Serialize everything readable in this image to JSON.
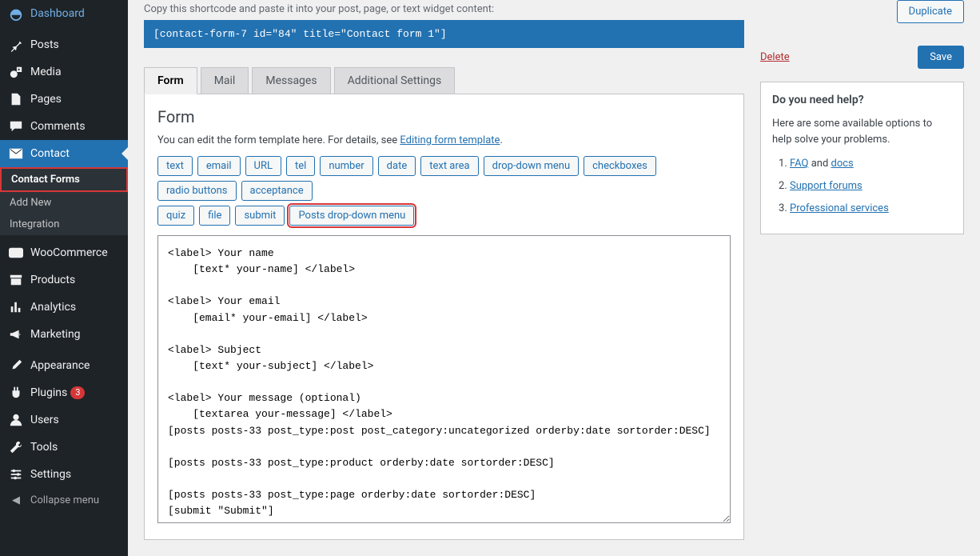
{
  "sidebar": {
    "items": [
      {
        "label": "Dashboard",
        "icon": "dashboard"
      },
      {
        "label": "Posts",
        "icon": "pin"
      },
      {
        "label": "Media",
        "icon": "media"
      },
      {
        "label": "Pages",
        "icon": "page"
      },
      {
        "label": "Comments",
        "icon": "comment"
      },
      {
        "label": "Contact",
        "icon": "mail",
        "active": true
      },
      {
        "label": "WooCommerce",
        "icon": "woo"
      },
      {
        "label": "Products",
        "icon": "archive"
      },
      {
        "label": "Analytics",
        "icon": "chart"
      },
      {
        "label": "Marketing",
        "icon": "megaphone"
      },
      {
        "label": "Appearance",
        "icon": "brush"
      },
      {
        "label": "Plugins",
        "icon": "plug",
        "badge": "3"
      },
      {
        "label": "Users",
        "icon": "user"
      },
      {
        "label": "Tools",
        "icon": "wrench"
      },
      {
        "label": "Settings",
        "icon": "slider"
      }
    ],
    "submenu": [
      {
        "label": "Contact Forms",
        "current": true
      },
      {
        "label": "Add New"
      },
      {
        "label": "Integration"
      }
    ],
    "collapse": "Collapse menu"
  },
  "instr": "Copy this shortcode and paste it into your post, page, or text widget content:",
  "shortcode": "[contact-form-7 id=\"84\" title=\"Contact form 1\"]",
  "tabs": [
    "Form",
    "Mail",
    "Messages",
    "Additional Settings"
  ],
  "panel": {
    "title": "Form",
    "hint_pre": "You can edit the form template here. For details, see ",
    "hint_link": "Editing form template",
    "hint_post": "."
  },
  "tags_row1": [
    "text",
    "email",
    "URL",
    "tel",
    "number",
    "date",
    "text area",
    "drop-down menu",
    "checkboxes",
    "radio buttons",
    "acceptance"
  ],
  "tags_row2": [
    "quiz",
    "file",
    "submit"
  ],
  "tag_highlight": "Posts drop-down menu",
  "code": "<label> Your name\n    [text* your-name] </label>\n\n<label> Your email\n    [email* your-email] </label>\n\n<label> Subject\n    [text* your-subject] </label>\n\n<label> Your message (optional)\n    [textarea your-message] </label>\n[posts posts-33 post_type:post post_category:uncategorized orderby:date sortorder:DESC]\n\n[posts posts-33 post_type:product orderby:date sortorder:DESC]\n\n[posts posts-33 post_type:page orderby:date sortorder:DESC]\n[submit \"Submit\"]",
  "right": {
    "duplicate": "Duplicate",
    "delete": "Delete",
    "save": "Save",
    "help_title": "Do you need help?",
    "help_p": "Here are some available options to help solve your problems.",
    "links": [
      {
        "pre": "",
        "a": "FAQ",
        "mid": " and ",
        "a2": "docs",
        "post": ""
      },
      {
        "a": "Support forums"
      },
      {
        "a": "Professional services"
      }
    ]
  }
}
